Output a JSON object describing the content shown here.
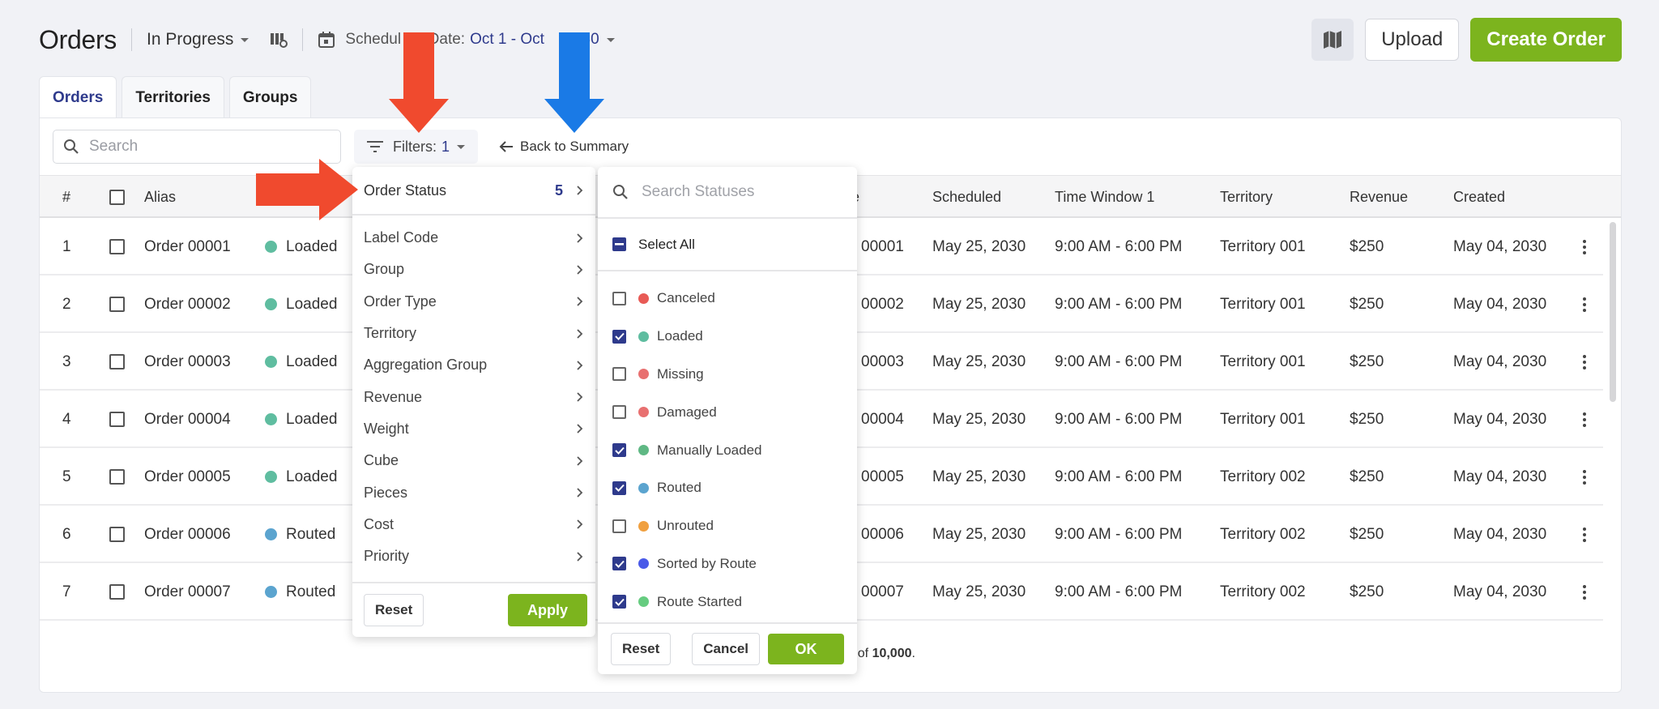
{
  "header": {
    "title": "Orders",
    "view_select": "In Progress",
    "schedule_label": "Schedul",
    "schedule_label_tail": "r Date:",
    "date_range_visible": "Oct 1 - Oct",
    "date_range_tail": "030",
    "icons": {
      "columns": "columns-settings-icon",
      "calendar": "calendar-icon",
      "map": "map-icon"
    },
    "upload_label": "Upload",
    "create_label": "Create Order"
  },
  "tabs": [
    {
      "label": "Orders",
      "active": true
    },
    {
      "label": "Territories",
      "active": false
    },
    {
      "label": "Groups",
      "active": false
    }
  ],
  "toolbar": {
    "search_placeholder": "Search",
    "filters_label": "Filters:",
    "filters_count": "1",
    "back_label": "Back to Summary"
  },
  "table": {
    "columns": [
      "#",
      "Alias",
      "Scheduled",
      "Time Window 1",
      "Territory",
      "Revenue",
      "Created"
    ],
    "partial_column_tail": "e",
    "rows": [
      {
        "num": "1",
        "alias": "Order 00001",
        "status": "Loaded",
        "status_color": "#5fbda0",
        "id_tail": "00001",
        "scheduled": "May 25, 2030",
        "window": "9:00 AM - 6:00 PM",
        "territory": "Territory 001",
        "revenue": "$250",
        "created": "May 04, 2030"
      },
      {
        "num": "2",
        "alias": "Order 00002",
        "status": "Loaded",
        "status_color": "#5fbda0",
        "id_tail": "00002",
        "scheduled": "May 25, 2030",
        "window": "9:00 AM - 6:00 PM",
        "territory": "Territory 001",
        "revenue": "$250",
        "created": "May 04, 2030"
      },
      {
        "num": "3",
        "alias": "Order 00003",
        "status": "Loaded",
        "status_color": "#5fbda0",
        "id_tail": "00003",
        "scheduled": "May 25, 2030",
        "window": "9:00 AM - 6:00 PM",
        "territory": "Territory 001",
        "revenue": "$250",
        "created": "May 04, 2030"
      },
      {
        "num": "4",
        "alias": "Order 00004",
        "status": "Loaded",
        "status_color": "#5fbda0",
        "id_tail": "00004",
        "scheduled": "May 25, 2030",
        "window": "9:00 AM - 6:00 PM",
        "territory": "Territory 001",
        "revenue": "$250",
        "created": "May 04, 2030"
      },
      {
        "num": "5",
        "alias": "Order 00005",
        "status": "Loaded",
        "status_color": "#5fbda0",
        "id_tail": "00005",
        "scheduled": "May 25, 2030",
        "window": "9:00 AM - 6:00 PM",
        "territory": "Territory 002",
        "revenue": "$250",
        "created": "May 04, 2030"
      },
      {
        "num": "6",
        "alias": "Order 00006",
        "status": "Routed",
        "status_color": "#5ba4cf",
        "id_tail": "00006",
        "scheduled": "May 25, 2030",
        "window": "9:00 AM - 6:00 PM",
        "territory": "Territory 002",
        "revenue": "$250",
        "created": "May 04, 2030"
      },
      {
        "num": "7",
        "alias": "Order 00007",
        "status": "Routed",
        "status_color": "#5ba4cf",
        "id_tail": "00007",
        "scheduled": "May 25, 2030",
        "window": "9:00 AM - 6:00 PM",
        "territory": "Territory 002",
        "revenue": "$250",
        "created": "May 04, 2030"
      }
    ],
    "footer_prefix": ") of ",
    "footer_total": "10,000",
    "footer_suffix": "."
  },
  "filter_menu": {
    "active_item": {
      "label": "Order Status",
      "count": "5"
    },
    "items": [
      "Label Code",
      "Group",
      "Order Type",
      "Territory",
      "Aggregation Group",
      "Revenue",
      "Weight",
      "Cube",
      "Pieces",
      "Cost",
      "Priority"
    ],
    "reset_label": "Reset",
    "apply_label": "Apply"
  },
  "status_menu": {
    "search_placeholder": "Search Statuses",
    "select_all_label": "Select All",
    "select_all_state": "indeterminate",
    "statuses": [
      {
        "label": "Canceled",
        "color": "#e85a55",
        "checked": false
      },
      {
        "label": "Loaded",
        "color": "#5fbda0",
        "checked": true
      },
      {
        "label": "Missing",
        "color": "#e87070",
        "checked": false
      },
      {
        "label": "Damaged",
        "color": "#e87070",
        "checked": false
      },
      {
        "label": "Manually Loaded",
        "color": "#5fb884",
        "checked": true
      },
      {
        "label": "Routed",
        "color": "#5ba4cf",
        "checked": true
      },
      {
        "label": "Unrouted",
        "color": "#f0a040",
        "checked": false
      },
      {
        "label": "Sorted by Route",
        "color": "#4a5ae8",
        "checked": true
      },
      {
        "label": "Route Started",
        "color": "#66cc80",
        "checked": true
      }
    ],
    "reset_label": "Reset",
    "cancel_label": "Cancel",
    "ok_label": "OK"
  },
  "colors": {
    "accent_green": "#7cb41e",
    "accent_navy": "#2e3a8c",
    "annotation_red": "#f04a2e",
    "annotation_blue": "#1a7ae6"
  }
}
